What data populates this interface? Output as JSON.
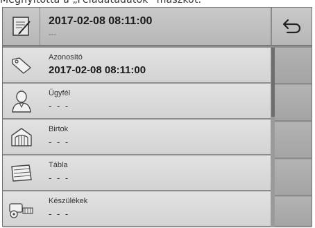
{
  "caption": "Megnyitotta a „Feladatadatok” maszkot.",
  "header": {
    "title": "2017-02-08 08:11:00",
    "subtitle": "---",
    "icon": "notepad-icon",
    "back_icon": "back-arrow-icon"
  },
  "rows": [
    {
      "label": "Azonosító",
      "value": "2017-02-08 08:11:00",
      "icon": "tag-icon"
    },
    {
      "label": "Ügyfél",
      "value": "- - -",
      "icon": "person-icon"
    },
    {
      "label": "Birtok",
      "value": "- - -",
      "icon": "barn-icon"
    },
    {
      "label": "Tábla",
      "value": "- - -",
      "icon": "field-icon"
    },
    {
      "label": "Készülékek",
      "value": "- - -",
      "icon": "tractor-icon"
    }
  ]
}
